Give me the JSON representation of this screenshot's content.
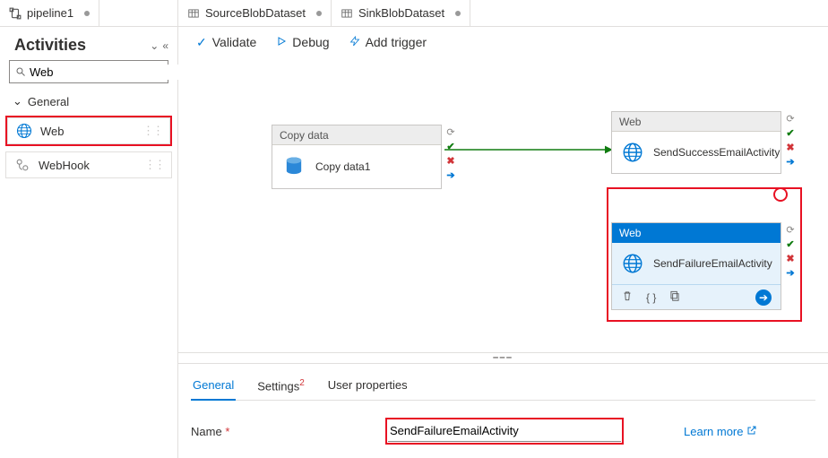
{
  "tabs": {
    "pipeline": {
      "label": "pipeline1"
    },
    "dataset1": {
      "label": "SourceBlobDataset"
    },
    "dataset2": {
      "label": "SinkBlobDataset"
    }
  },
  "activities": {
    "title": "Activities",
    "search_value": "Web",
    "group_general": "General",
    "items": {
      "web": {
        "label": "Web"
      },
      "webhook": {
        "label": "WebHook"
      }
    }
  },
  "toolbar": {
    "validate": "Validate",
    "debug": "Debug",
    "add_trigger": "Add trigger"
  },
  "canvas": {
    "copy": {
      "head": "Copy data",
      "title": "Copy data1"
    },
    "success": {
      "head": "Web",
      "title": "SendSuccessEmailActivity"
    },
    "failure": {
      "head": "Web",
      "title": "SendFailureEmailActivity"
    }
  },
  "detail": {
    "tabs": {
      "general": "General",
      "settings": "Settings",
      "settings_badge": "2",
      "userprops": "User properties"
    },
    "name_label": "Name",
    "name_value": "SendFailureEmailActivity",
    "learn_more": "Learn more"
  }
}
